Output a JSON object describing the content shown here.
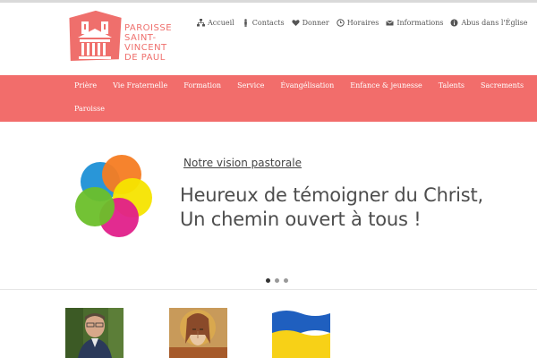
{
  "logo": {
    "line1": "PAROISSE",
    "line2": "SAINT-",
    "line3": "VINCENT",
    "line4": "DE PAUL",
    "color": "#ef6f6c"
  },
  "topnav": [
    {
      "label": "Accueil",
      "icon": "sitemap-icon"
    },
    {
      "label": "Contacts",
      "icon": "person-icon"
    },
    {
      "label": "Donner",
      "icon": "heart-icon"
    },
    {
      "label": "Horaires",
      "icon": "clock-icon"
    },
    {
      "label": "Informations",
      "icon": "envelope-icon"
    },
    {
      "label": "Abus dans l'Église",
      "icon": "info-icon"
    }
  ],
  "mainnav": {
    "color": "#f26d6b",
    "items": [
      "Prière",
      "Vie Fraternelle",
      "Formation",
      "Service",
      "Évangélisation",
      "Enfance & jeunesse",
      "Talents",
      "Sacrements",
      "Paroisse"
    ]
  },
  "hero": {
    "link": "Notre vision pastorale",
    "slogan_line1": "Heureux de témoigner du Christ,",
    "slogan_line2": "Un chemin ouvert à tous !",
    "slides": 3,
    "active_slide": 1
  },
  "thumbnails": [
    "priest-portrait",
    "christ-icon-painting",
    "ukraine-flag"
  ]
}
